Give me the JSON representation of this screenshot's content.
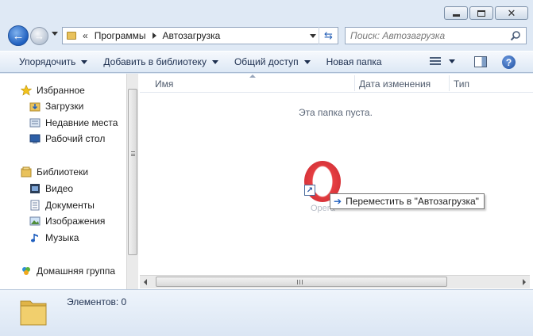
{
  "window": {
    "controls": {
      "minimize": "minimize-icon",
      "maximize": "maximize-icon",
      "close": "close-icon"
    }
  },
  "nav": {
    "breadcrumbs": [
      "Программы",
      "Автозагрузка"
    ],
    "overflow_glyph": "«",
    "search_placeholder": "Поиск: Автозагрузка"
  },
  "toolbar": {
    "organize": "Упорядочить",
    "add_to_library": "Добавить в библиотеку",
    "share": "Общий доступ",
    "new_folder": "Новая папка"
  },
  "sidebar": {
    "favorites_header": "Избранное",
    "favorites": [
      "Загрузки",
      "Недавние места",
      "Рабочий стол"
    ],
    "libraries_header": "Библиотеки",
    "libraries": [
      "Видео",
      "Документы",
      "Изображения",
      "Музыка"
    ],
    "homegroup": "Домашняя группа"
  },
  "columns": {
    "name": "Имя",
    "date_modified": "Дата изменения",
    "type": "Тип"
  },
  "content": {
    "empty_text": "Эта папка пуста.",
    "dragged_item_label": "Opera",
    "drag_tooltip": "Переместить в \"Автозагрузка\""
  },
  "details": {
    "item_count": "Элементов: 0"
  },
  "colors": {
    "accent": "#1f5fbf",
    "window_bg": "#dfe9f5",
    "opera_red": "#d8161d"
  }
}
